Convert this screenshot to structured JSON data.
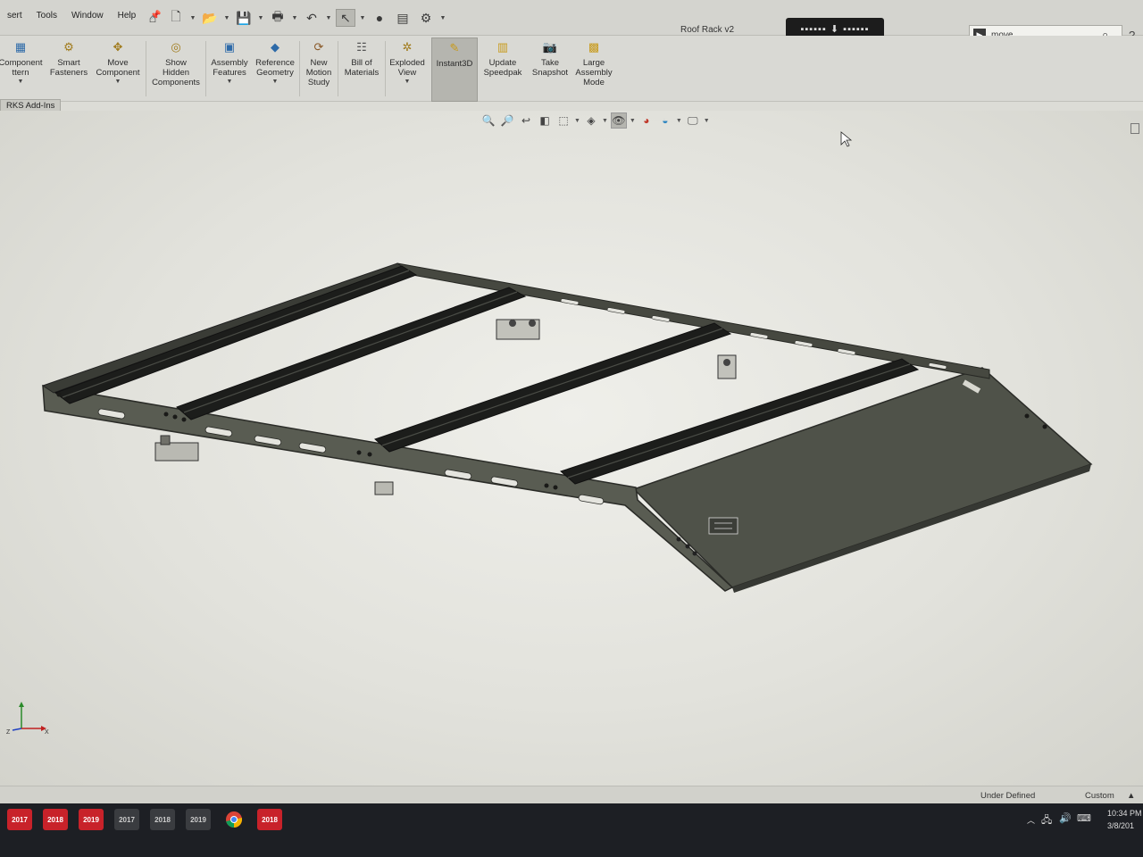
{
  "menu": [
    "sert",
    "Tools",
    "Window",
    "Help"
  ],
  "document_title": "Roof Rack v2",
  "search": {
    "value": "move",
    "icon": "command-search-icon"
  },
  "ribbon": {
    "commands": [
      {
        "label": "Component\nttern",
        "icon": "linear-pattern-icon"
      },
      {
        "label": "Smart\nFasteners",
        "icon": "fastener-icon"
      },
      {
        "label": "Move\nComponent",
        "icon": "move-component-icon"
      },
      {
        "label": "Show\nHidden\nComponents",
        "icon": "show-hidden-icon"
      },
      {
        "label": "Assembly\nFeatures",
        "icon": "assembly-features-icon"
      },
      {
        "label": "Reference\nGeometry",
        "icon": "reference-geometry-icon"
      },
      {
        "label": "New\nMotion\nStudy",
        "icon": "motion-study-icon"
      },
      {
        "label": "Bill of\nMaterials",
        "icon": "bom-icon"
      },
      {
        "label": "Exploded\nView",
        "icon": "exploded-view-icon"
      },
      {
        "label": "Instant3D",
        "icon": "instant3d-icon"
      },
      {
        "label": "Update\nSpeedpak",
        "icon": "speedpak-icon"
      },
      {
        "label": "Take\nSnapshot",
        "icon": "camera-icon"
      },
      {
        "label": "Large\nAssembly\nMode",
        "icon": "large-assembly-icon"
      }
    ],
    "tab_label": "RKS Add-Ins"
  },
  "status": {
    "state": "Under Defined",
    "units": "Custom"
  },
  "clock": {
    "time": "10:34 PM",
    "date": "3/8/201"
  },
  "taskbar": {
    "apps": [
      {
        "label": "2017",
        "kind": "solidworks"
      },
      {
        "label": "2018",
        "kind": "solidworks"
      },
      {
        "label": "2019",
        "kind": "solidworks"
      },
      {
        "label": "2017",
        "kind": "composer"
      },
      {
        "label": "2018",
        "kind": "composer"
      },
      {
        "label": "2019",
        "kind": "composer"
      },
      {
        "label": "",
        "kind": "chrome"
      },
      {
        "label": "2018",
        "kind": "solidworks"
      }
    ]
  },
  "triad_labels": {
    "z": "Z",
    "x": "X"
  }
}
